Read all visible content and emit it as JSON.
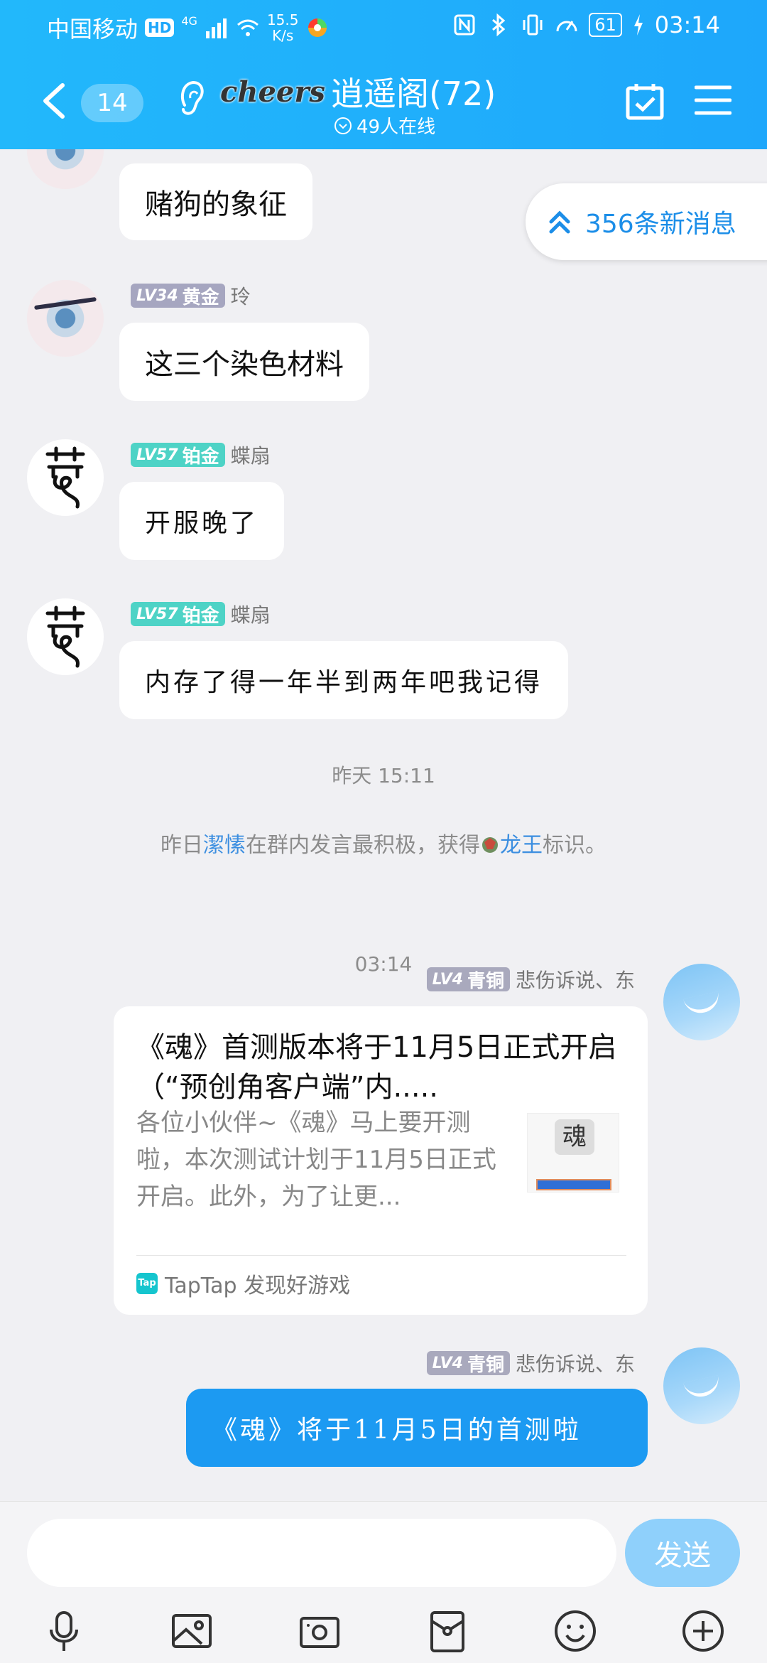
{
  "status_bar": {
    "carrier": "中国移动",
    "hd": "HD",
    "network": "4G",
    "speed_value": "15.5",
    "speed_unit": "K/s",
    "battery": "61",
    "time": "03:14"
  },
  "header": {
    "unread_count": "14",
    "group_logo_text": "cheers",
    "group_name": "逍遥阁(72)",
    "online_text": "49人在线"
  },
  "new_messages_pill": "356条新消息",
  "messages": [
    {
      "text": "赌狗的象征"
    },
    {
      "level": "LV34",
      "rank": "黄金",
      "sender": "玲",
      "text": "这三个染色材料"
    },
    {
      "level": "LV57",
      "rank": "铂金",
      "sender": "蝶扇",
      "text": "开服晚了"
    },
    {
      "level": "LV57",
      "rank": "铂金",
      "sender": "蝶扇",
      "text": "内存了得一年半到两年吧我记得"
    }
  ],
  "system": {
    "time1": "昨天 15:11",
    "notice_prefix": "昨日",
    "notice_user": "潔愫",
    "notice_middle": "在群内发言最积极，获得",
    "notice_badge": "龙王",
    "notice_suffix": "标识。",
    "time2": "03:14"
  },
  "my_messages": [
    {
      "level": "LV4",
      "rank": "青铜",
      "sender": "悲伤诉说、东",
      "card_title": "《魂》首测版本将于11月5日正式开启（“预创角客户端”内.....",
      "card_desc": "各位小伙伴~《魂》马上要开测啦，本次测试计划于11月5日正式开启。此外，为了让更...",
      "card_source": "TapTap 发现好游戏",
      "tap_icon_label": "Tap"
    },
    {
      "level": "LV4",
      "rank": "青铜",
      "sender": "悲伤诉说、东",
      "text": "《魂》将于11月5日的首测啦"
    }
  ],
  "input": {
    "placeholder": "",
    "send_label": "发送"
  },
  "icons": [
    "back-icon",
    "ear-icon",
    "calendar-check-icon",
    "menu-icon",
    "double-chevron-up-icon",
    "microphone-icon",
    "image-icon",
    "camera-icon",
    "red-packet-icon",
    "emoji-icon",
    "plus-icon"
  ],
  "colors": {
    "header": "#1ea7fb",
    "my_bubble": "#1c9af2",
    "send_button": "#8fd0fb",
    "link": "#3b8ee0"
  }
}
